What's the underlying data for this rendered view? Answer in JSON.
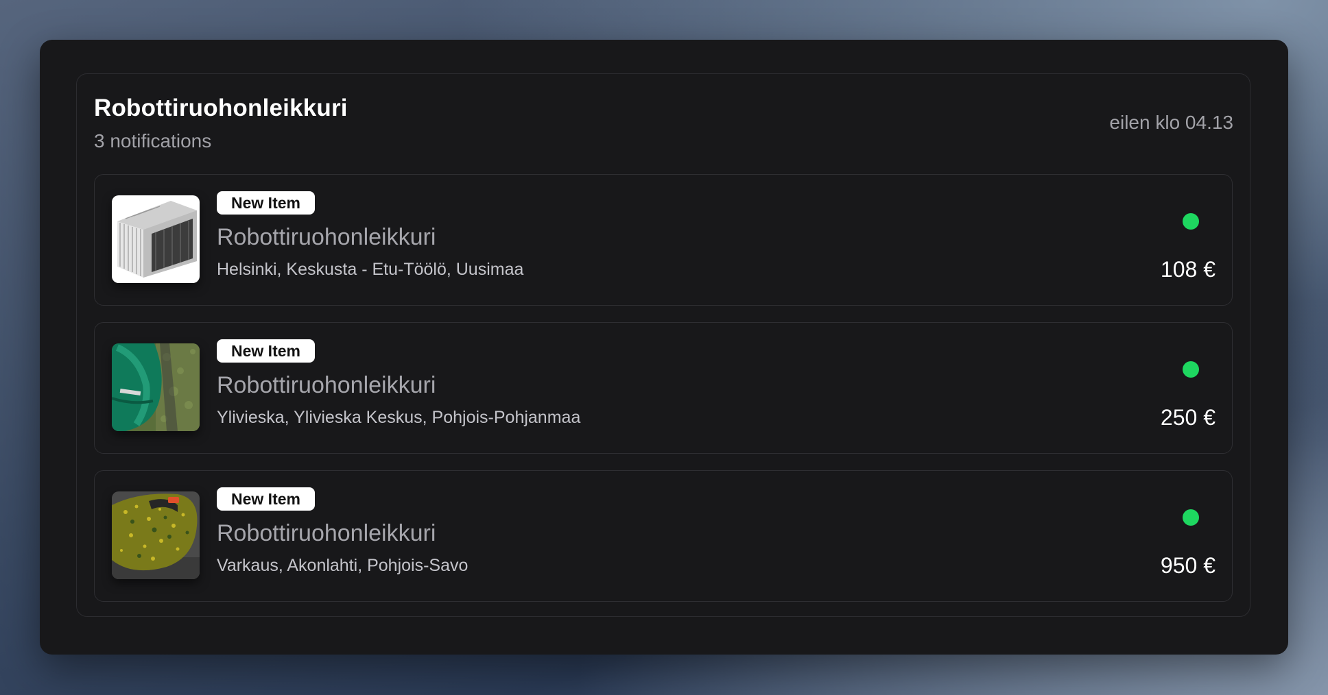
{
  "header": {
    "title": "Robottiruohonleikkuri",
    "subtitle": "3 notifications",
    "timestamp": "eilen klo 04.13"
  },
  "colors": {
    "window_bg": "#18181a",
    "status_active": "#1ed760",
    "badge_bg": "#ffffff"
  },
  "items": [
    {
      "badge": "New Item",
      "title": "Robottiruohonleikkuri",
      "location": "Helsinki, Keskusta - Etu-Töölö, Uusimaa",
      "price": "108 €",
      "image": "garage-shelter-image",
      "status": "active"
    },
    {
      "badge": "New Item",
      "title": "Robottiruohonleikkuri",
      "location": "Ylivieska, Ylivieska Keskus, Pohjois-Pohjanmaa",
      "price": "250 €",
      "image": "green-mower-image",
      "status": "active"
    },
    {
      "badge": "New Item",
      "title": "Robottiruohonleikkuri",
      "location": "Varkaus, Akonlahti, Pohjois-Savo",
      "price": "950 €",
      "image": "glitter-mower-image",
      "status": "active"
    }
  ]
}
